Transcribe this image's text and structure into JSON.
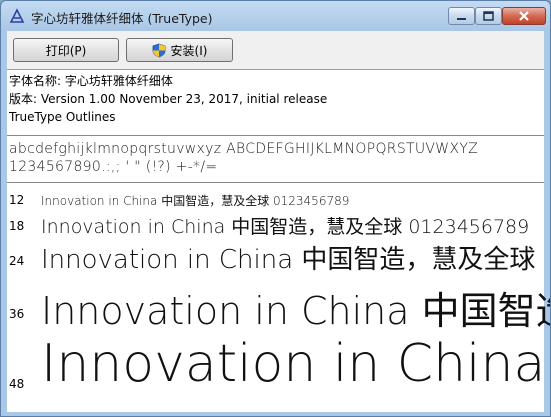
{
  "window": {
    "title": "字心坊轩雅体纤细体 (TrueType)"
  },
  "toolbar": {
    "print_label": "打印(P)",
    "install_label": "安装(I)"
  },
  "info": {
    "font_name": "字体名称: 字心坊轩雅体纤细体",
    "version": "版本: Version 1.00 November 23, 2017, initial release",
    "outline_type": "TrueType Outlines"
  },
  "charset": {
    "line1": "abcdefghijklmnopqrstuvwxyz ABCDEFGHIJKLMNOPQRSTUVWXYZ",
    "line2": "1234567890.:,; ' \" (!?) +-*/="
  },
  "samples": [
    {
      "size": "12",
      "text": "Innovation in China 中国智造，慧及全球 0123456789"
    },
    {
      "size": "18",
      "text": "Innovation in China 中国智造，慧及全球 0123456789"
    },
    {
      "size": "24",
      "text": "Innovation in China 中国智造，慧及全球"
    },
    {
      "size": "36",
      "text": "Innovation in China 中国智造"
    },
    {
      "size": "48",
      "text": "Innovation in China"
    }
  ],
  "colors": {
    "title_bar": "#a9c7e6",
    "close_button": "#c0442b",
    "toolbar_bg": "#f0f0f0"
  },
  "icons": {
    "app": "font-app-icon",
    "install": "uac-shield-icon"
  }
}
